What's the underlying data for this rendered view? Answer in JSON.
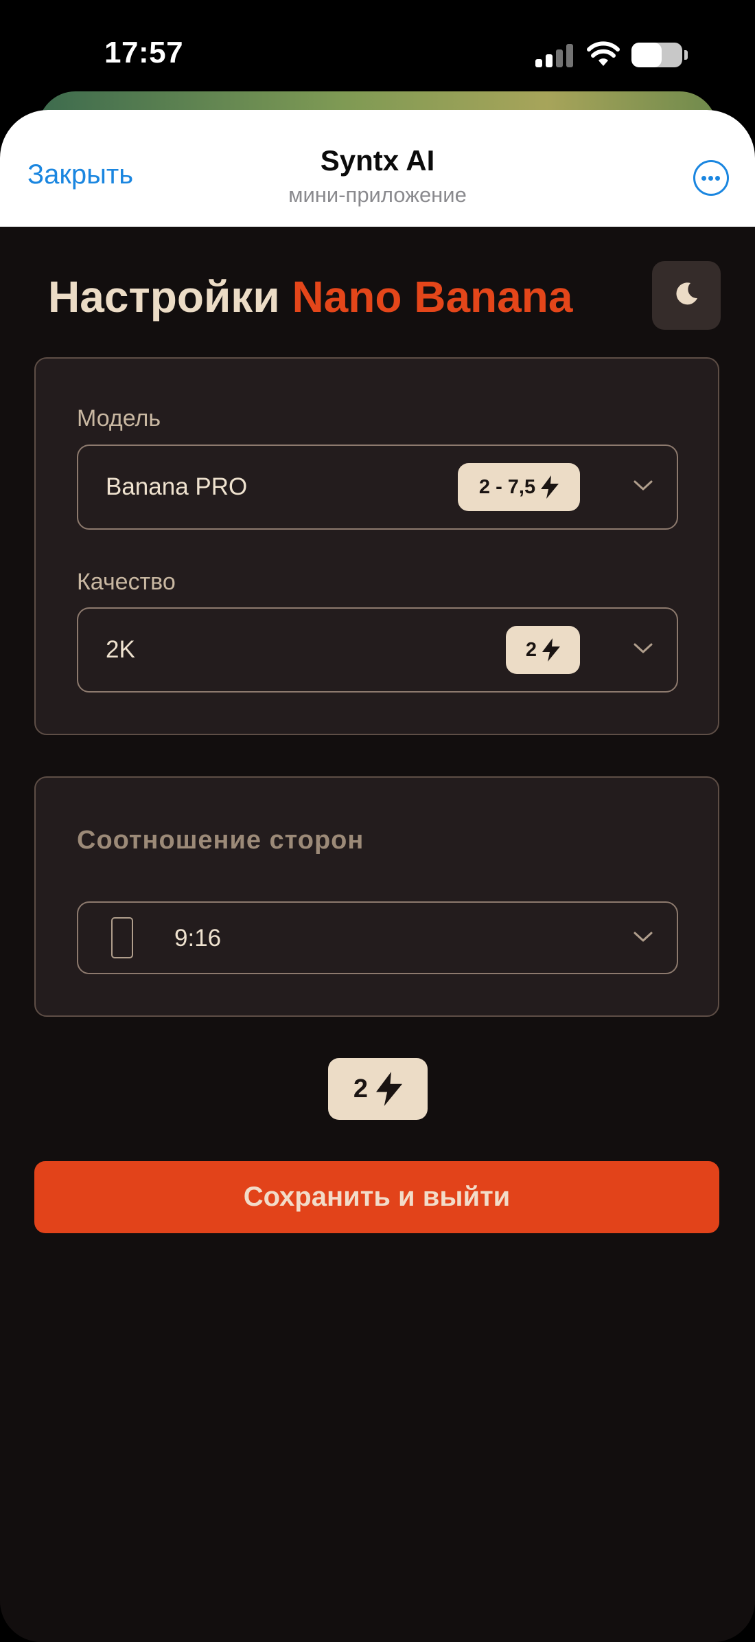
{
  "status_bar": {
    "time": "17:57",
    "signal_bars": 4,
    "signal_bars_active": 2,
    "battery_level": 0.6,
    "icons": [
      "cellular-signal-icon",
      "wifi-icon",
      "battery-icon"
    ]
  },
  "header": {
    "close_label": "Закрыть",
    "title": "Syntx AI",
    "subtitle": "мини-приложение",
    "more_icon": "ellipsis-circle-icon",
    "accent_color": "#1a86e0"
  },
  "page": {
    "title_main": "Настройки",
    "title_accent": "Nano Banana",
    "theme_icon": "moon-icon",
    "accent_color": "#e4461a"
  },
  "settings": {
    "model": {
      "label": "Модель",
      "value": "Banana PRO",
      "cost": "2 - 7,5",
      "cost_icon": "lightning-icon",
      "dropdown_icon": "chevron-down-icon"
    },
    "quality": {
      "label": "Качество",
      "value": "2K",
      "cost": "2",
      "cost_icon": "lightning-icon",
      "dropdown_icon": "chevron-down-icon"
    },
    "aspect_ratio": {
      "label": "Соотношение сторон",
      "value": "9:16",
      "ratio_icon": "portrait-phone-icon",
      "dropdown_icon": "chevron-down-icon"
    }
  },
  "total": {
    "cost": "2",
    "icon": "lightning-icon"
  },
  "save_button": {
    "label": "Сохранить и выйти",
    "color": "#e2431a"
  }
}
